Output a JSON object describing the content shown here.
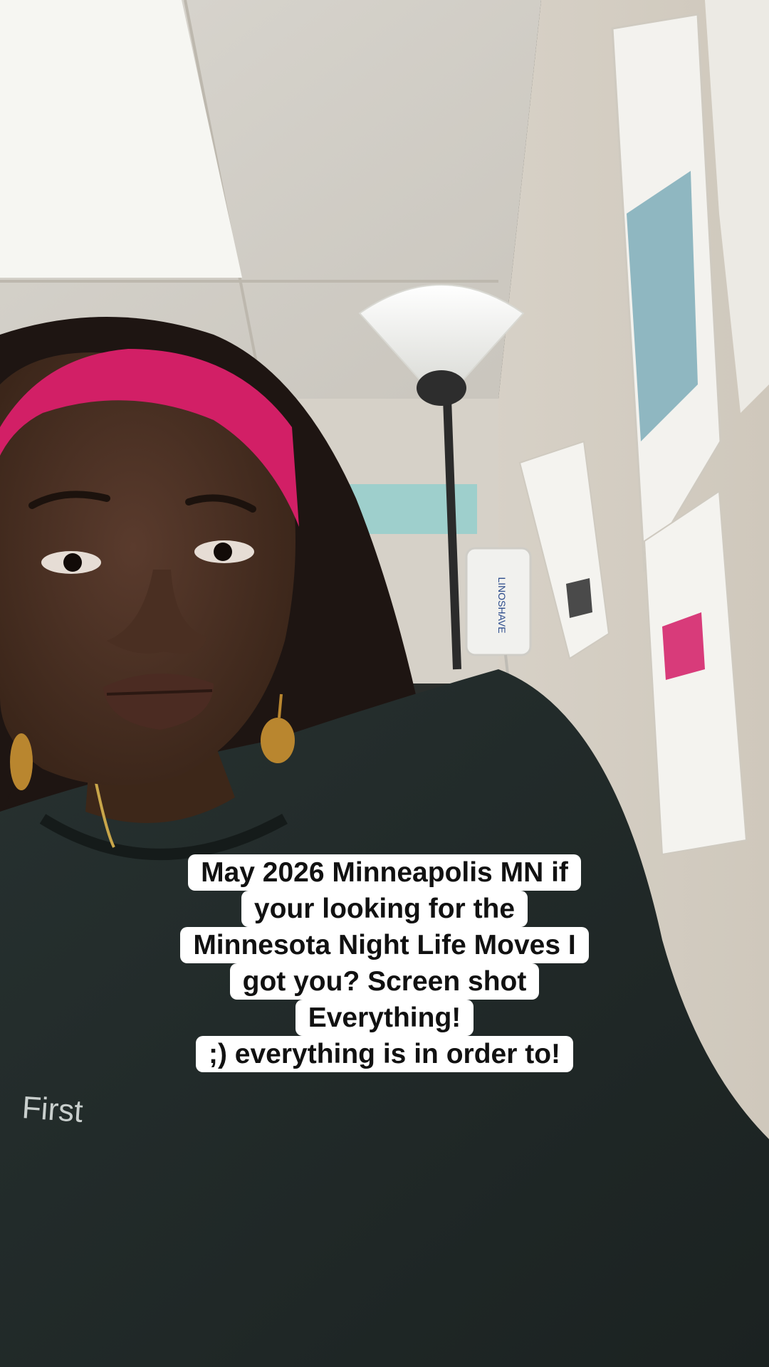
{
  "caption": {
    "lines": [
      "May 2026 Minneapolis MN if",
      "your looking for the",
      "Minnesota Night Life Moves I",
      "got you? Screen shot",
      "Everything!",
      ";) everything is in order to!"
    ]
  },
  "scene": {
    "sweatshirt_text": "First",
    "device_label": "LINOSHAVE"
  }
}
